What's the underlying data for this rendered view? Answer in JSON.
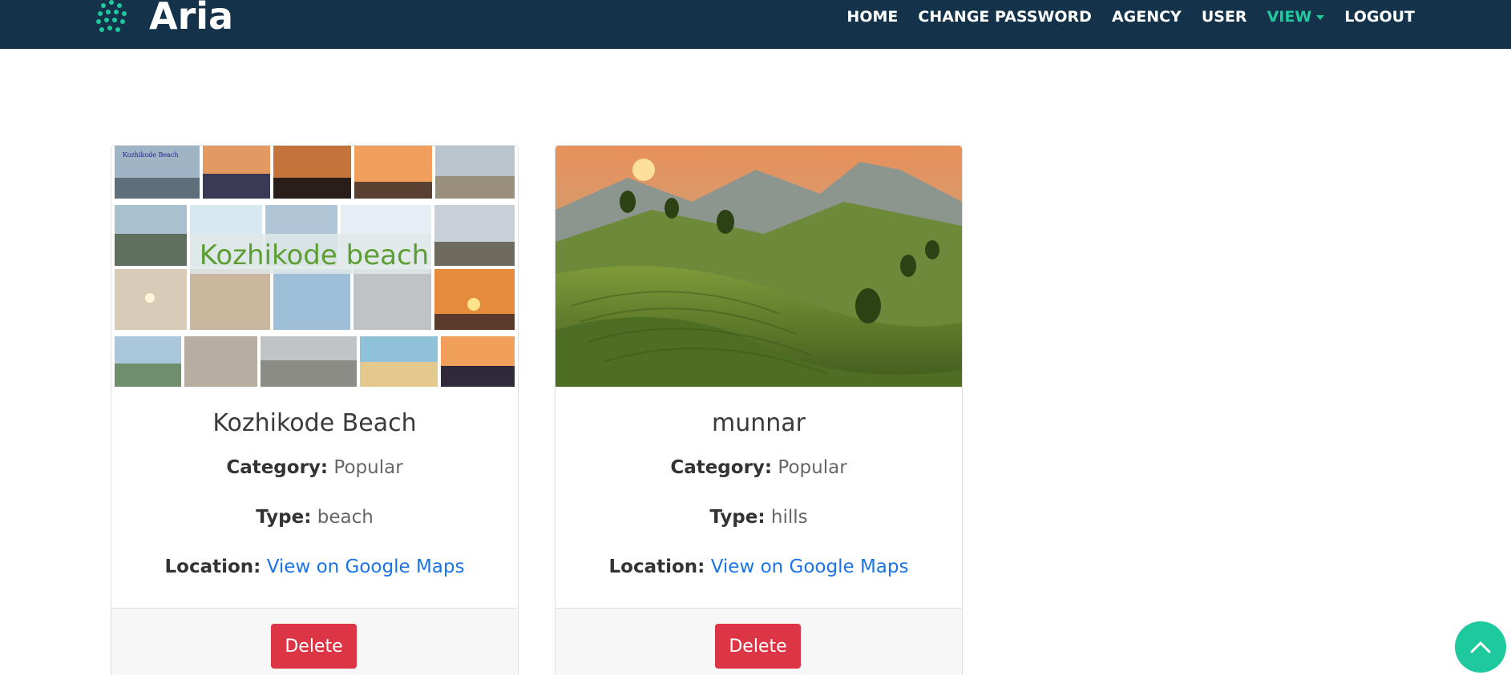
{
  "brand": {
    "name": "Aria"
  },
  "nav": {
    "items": [
      {
        "label": "HOME"
      },
      {
        "label": "CHANGE PASSWORD"
      },
      {
        "label": "AGENCY"
      },
      {
        "label": "USER"
      },
      {
        "label": "VIEW"
      },
      {
        "label": "LOGOUT"
      }
    ]
  },
  "places": [
    {
      "title": "Kozhikode Beach",
      "image_caption": "Kozhikode beach",
      "image_tag": "Kozhikode Beach",
      "category_label": "Category:",
      "category": "Popular",
      "type_label": "Type:",
      "type": "beach",
      "location_label": "Location:",
      "location_link": "View on Google Maps",
      "delete_label": "Delete"
    },
    {
      "title": "munnar",
      "category_label": "Category:",
      "category": "Popular",
      "type_label": "Type:",
      "type": "hills",
      "location_label": "Location:",
      "location_link": "View on Google Maps",
      "delete_label": "Delete"
    }
  ],
  "colors": {
    "navbar": "#14334a",
    "accent": "#1fc99e",
    "danger": "#dc3545",
    "link": "#1a73e8"
  },
  "icons": {
    "scroll_top": "chevron-up-icon"
  }
}
